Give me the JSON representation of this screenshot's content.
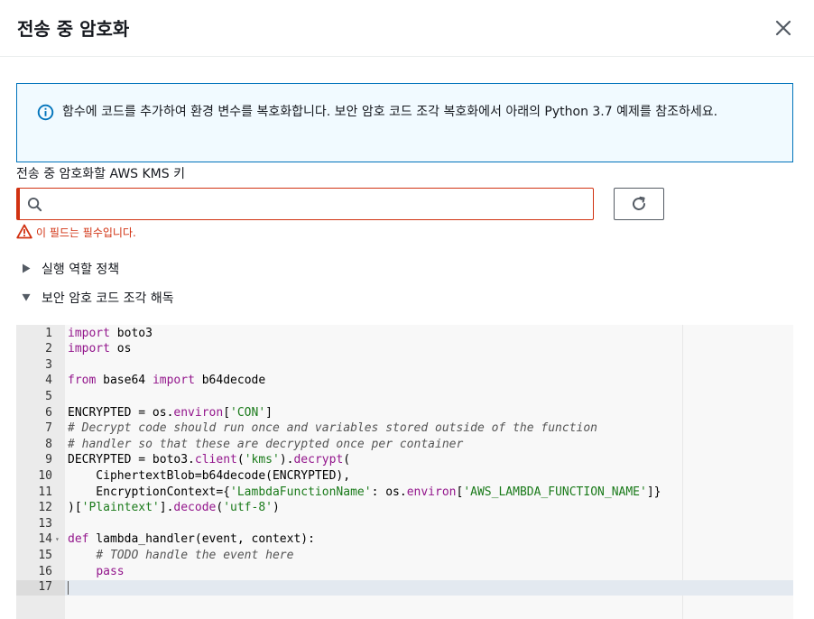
{
  "modal": {
    "title": "전송 중 암호화",
    "close_icon": "close-icon"
  },
  "info": {
    "icon": "info-circle-icon",
    "text": "함수에 코드를 추가하여 환경 변수를 복호화합니다. 보안 암호 코드 조각 복호화에서 아래의 Python 3.7 예제를 참조하세요.",
    "accent": "#0073bb"
  },
  "kms_field": {
    "label": "전송 중 암호화할 AWS KMS 키",
    "value": "",
    "placeholder": "",
    "error_text": "이 필드는 필수입니다.",
    "error_color": "#d13212",
    "search_icon": "search-icon",
    "refresh_icon": "refresh-icon"
  },
  "expanders": [
    {
      "label": "실행 역할 정책",
      "expanded": false
    },
    {
      "label": "보안 암호 코드 조각 해독",
      "expanded": true
    }
  ],
  "code": {
    "language": "python",
    "active_line": 17,
    "lines": [
      {
        "n": "1",
        "fold": "",
        "tokens": [
          [
            "kw",
            "import"
          ],
          [
            "id",
            " boto3"
          ]
        ]
      },
      {
        "n": "2",
        "fold": "",
        "tokens": [
          [
            "kw",
            "import"
          ],
          [
            "id",
            " os"
          ]
        ]
      },
      {
        "n": "3",
        "fold": "",
        "tokens": []
      },
      {
        "n": "4",
        "fold": "",
        "tokens": [
          [
            "kw",
            "from"
          ],
          [
            "id",
            " base64 "
          ],
          [
            "kw",
            "import"
          ],
          [
            "id",
            " b64decode"
          ]
        ]
      },
      {
        "n": "5",
        "fold": "",
        "tokens": []
      },
      {
        "n": "6",
        "fold": "",
        "tokens": [
          [
            "id",
            "ENCRYPTED = os."
          ],
          [
            "kw",
            "environ"
          ],
          [
            "id",
            "["
          ],
          [
            "str",
            "'CON'"
          ],
          [
            "id",
            "]"
          ]
        ]
      },
      {
        "n": "7",
        "fold": "",
        "tokens": [
          [
            "cm",
            "# Decrypt code should run once and variables stored outside of the function"
          ]
        ]
      },
      {
        "n": "8",
        "fold": "",
        "tokens": [
          [
            "cm",
            "# handler so that these are decrypted once per container"
          ]
        ]
      },
      {
        "n": "9",
        "fold": "",
        "tokens": [
          [
            "id",
            "DECRYPTED = boto3."
          ],
          [
            "kw",
            "client"
          ],
          [
            "id",
            "("
          ],
          [
            "str",
            "'kms'"
          ],
          [
            "id",
            ")."
          ],
          [
            "kw",
            "decrypt"
          ],
          [
            "id",
            "("
          ]
        ]
      },
      {
        "n": "10",
        "fold": "",
        "tokens": [
          [
            "id",
            "    CiphertextBlob=b64decode(ENCRYPTED),"
          ]
        ]
      },
      {
        "n": "11",
        "fold": "",
        "tokens": [
          [
            "id",
            "    EncryptionContext={"
          ],
          [
            "str",
            "'LambdaFunctionName'"
          ],
          [
            "id",
            ": os."
          ],
          [
            "kw",
            "environ"
          ],
          [
            "id",
            "["
          ],
          [
            "str",
            "'AWS_LAMBDA_FUNCTION_NAME'"
          ],
          [
            "id",
            "]}"
          ]
        ]
      },
      {
        "n": "12",
        "fold": "",
        "tokens": [
          [
            "id",
            ")["
          ],
          [
            "str",
            "'Plaintext'"
          ],
          [
            "id",
            "]."
          ],
          [
            "kw",
            "decode"
          ],
          [
            "id",
            "("
          ],
          [
            "str",
            "'utf-8'"
          ],
          [
            "id",
            ")"
          ]
        ]
      },
      {
        "n": "13",
        "fold": "",
        "tokens": []
      },
      {
        "n": "14",
        "fold": "▾",
        "tokens": [
          [
            "kw",
            "def"
          ],
          [
            "id",
            " lambda_handler(event, context):"
          ]
        ]
      },
      {
        "n": "15",
        "fold": "",
        "tokens": [
          [
            "id",
            "    "
          ],
          [
            "cm",
            "# TODO handle the event here"
          ]
        ]
      },
      {
        "n": "16",
        "fold": "",
        "tokens": [
          [
            "id",
            "    "
          ],
          [
            "kw",
            "pass"
          ]
        ]
      },
      {
        "n": "17",
        "fold": "",
        "tokens": []
      }
    ]
  }
}
